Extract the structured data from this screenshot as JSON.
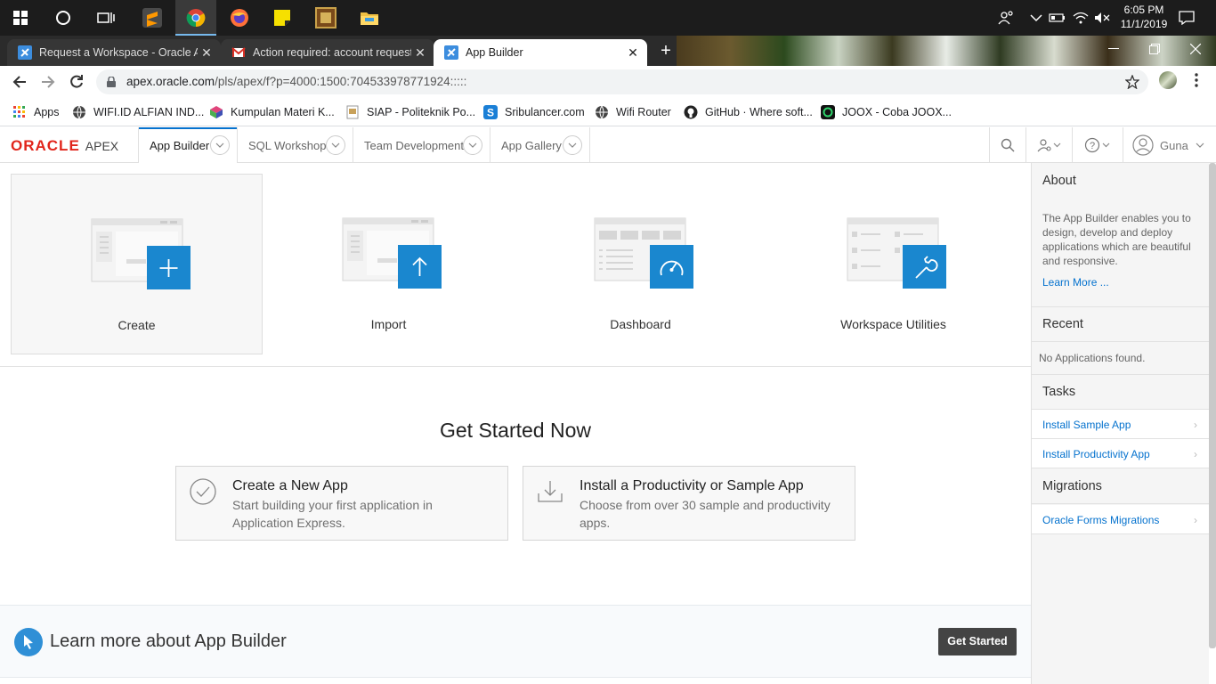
{
  "taskbar": {
    "time": "6:05 PM",
    "date": "11/1/2019",
    "apps": [
      "start-icon",
      "cortana-icon",
      "task-view-icon",
      "sublime-text-icon",
      "chrome-icon",
      "firefox-icon",
      "sticky-notes-icon",
      "dosbox-icon",
      "file-explorer-icon"
    ]
  },
  "browser": {
    "tabs": [
      {
        "title": "Request a Workspace - Oracle Ap",
        "icon": "apex-icon"
      },
      {
        "title": "Action required: account request",
        "icon": "gmail-icon"
      },
      {
        "title": "App Builder",
        "icon": "apex-icon"
      }
    ],
    "close_glyph": "✕",
    "new_tab_glyph": "+",
    "url_host": "apex.oracle.com",
    "url_path": "/pls/apex/f?p=4000:1500:704533978771924:::::"
  },
  "bookmarks": [
    {
      "label": "Apps",
      "icon": "apps-grid-icon"
    },
    {
      "label": "WIFI.ID ALFIAN IND...",
      "icon": "globe-icon"
    },
    {
      "label": "Kumpulan Materi K...",
      "icon": "cube-icon"
    },
    {
      "label": "SIAP - Politeknik Po...",
      "icon": "document-icon"
    },
    {
      "label": "Sribulancer.com",
      "icon": "sribulancer-icon"
    },
    {
      "label": "Wifi Router",
      "icon": "globe-icon"
    },
    {
      "label": "GitHub · Where soft...",
      "icon": "github-icon"
    },
    {
      "label": "JOOX - Coba JOOX...",
      "icon": "joox-icon"
    }
  ],
  "apex": {
    "logo_oracle": "ORACLE",
    "logo_apex": "APEX",
    "nav": [
      "App Builder",
      "SQL Workshop",
      "Team Development",
      "App Gallery"
    ],
    "user": "Guna"
  },
  "tiles": [
    "Create",
    "Import",
    "Dashboard",
    "Workspace Utilities"
  ],
  "get_started": {
    "heading": "Get Started Now",
    "cards": [
      {
        "title": "Create a New App",
        "desc": "Start building your first application in Application Express."
      },
      {
        "title": "Install a Productivity or Sample App",
        "desc": "Choose from over 30 sample and productivity apps."
      }
    ]
  },
  "learn": {
    "text": "Learn more about App Builder",
    "button": "Get Started"
  },
  "right_pane": {
    "about_title": "About",
    "about_text": "The App Builder enables you to design, develop and deploy applications which are beautiful and responsive.",
    "learn_more": "Learn More ...",
    "recent_title": "Recent",
    "recent_empty": "No Applications found.",
    "tasks_title": "Tasks",
    "tasks": [
      "Install Sample App",
      "Install Productivity App"
    ],
    "migrations_title": "Migrations",
    "migrations": [
      "Oracle Forms Migrations"
    ],
    "chevron_glyph": "›"
  },
  "colors": {
    "accent": "#1a87cf",
    "oracle_red": "#e1251b",
    "link": "#0572ce"
  }
}
